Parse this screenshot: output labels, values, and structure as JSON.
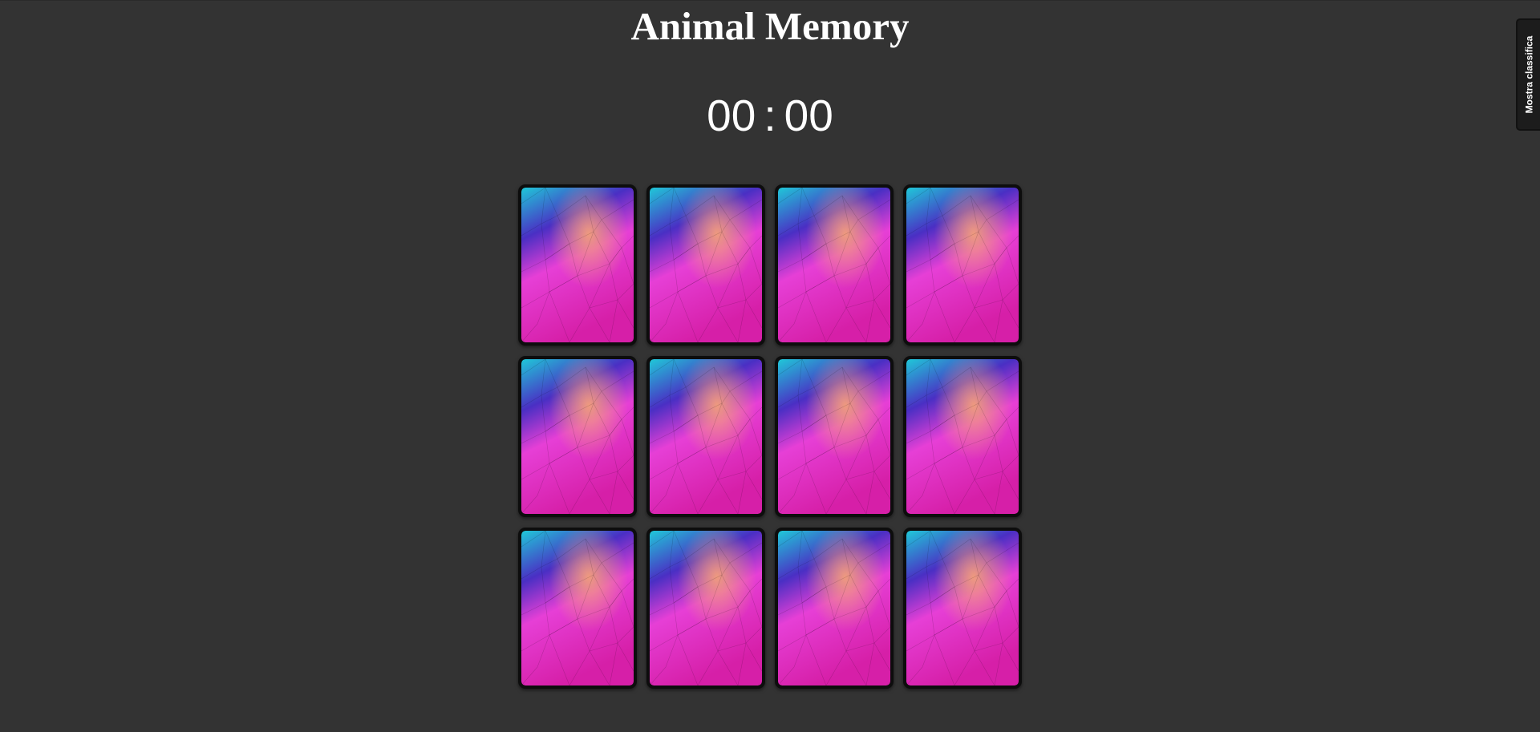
{
  "game": {
    "title": "Animal Memory"
  },
  "timer": {
    "minutes": "00",
    "separator": ":",
    "seconds": "00"
  },
  "leaderboard": {
    "toggle_label": "Mostra classifica"
  },
  "board": {
    "rows": 3,
    "columns": 4,
    "cards": [
      {
        "state": "face-down"
      },
      {
        "state": "face-down"
      },
      {
        "state": "face-down"
      },
      {
        "state": "face-down"
      },
      {
        "state": "face-down"
      },
      {
        "state": "face-down"
      },
      {
        "state": "face-down"
      },
      {
        "state": "face-down"
      },
      {
        "state": "face-down"
      },
      {
        "state": "face-down"
      },
      {
        "state": "face-down"
      },
      {
        "state": "face-down"
      }
    ],
    "card_back_colors": [
      "#1fc8d8",
      "#f2a07a",
      "#e63fd6",
      "#4a2fc4",
      "#d61fa8"
    ]
  }
}
